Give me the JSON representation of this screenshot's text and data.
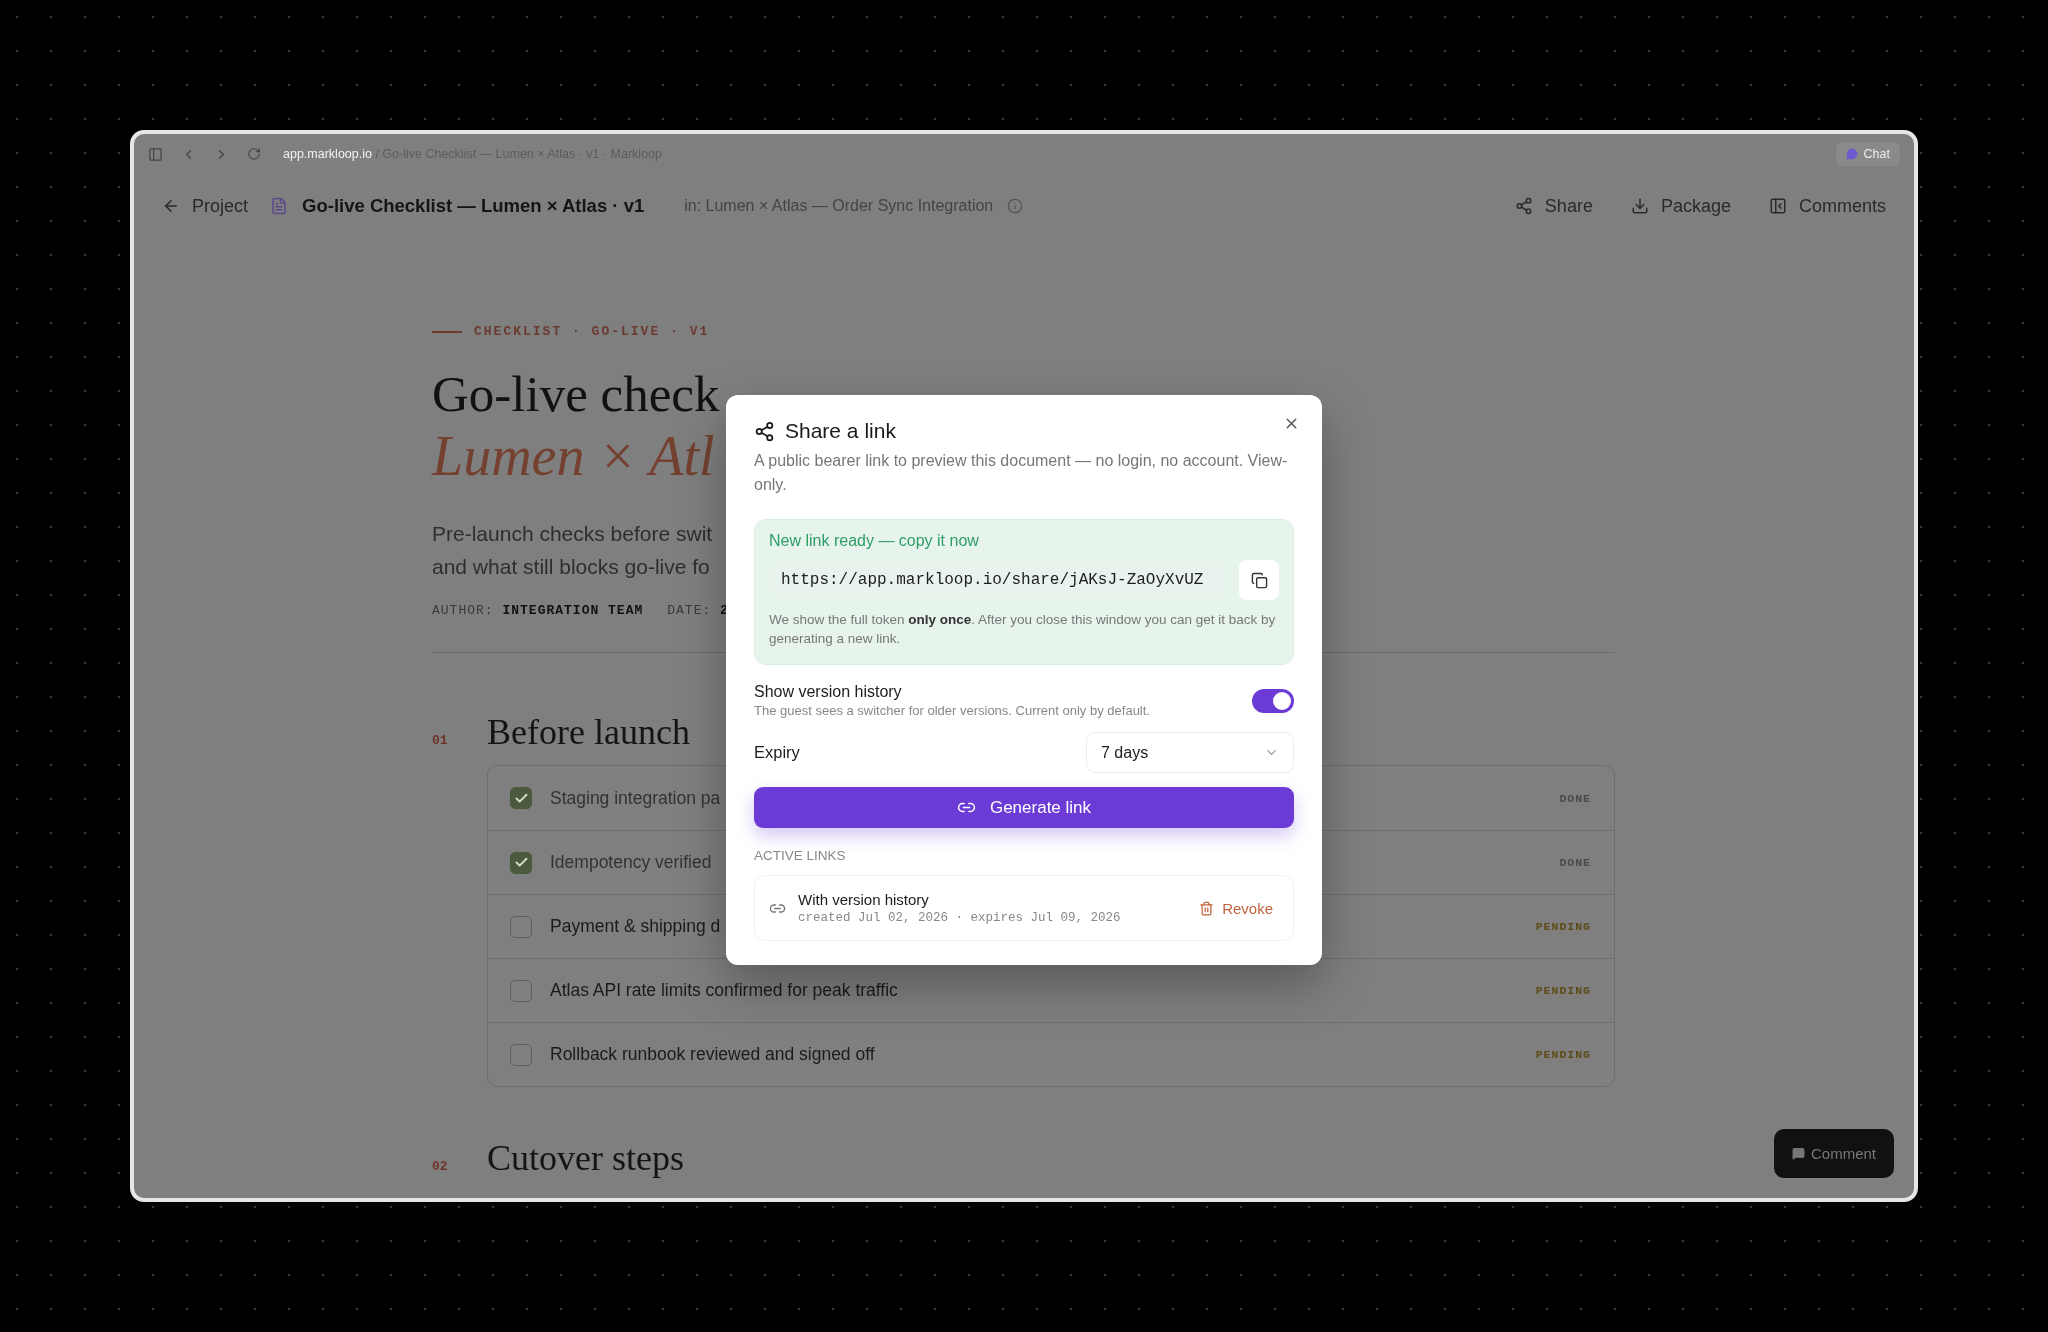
{
  "browser": {
    "url_host": "app.markloop.io",
    "url_path": " / Go-live Checklist — Lumen × Atlas · v1 · Markloop",
    "chat_button": "Chat"
  },
  "header": {
    "back_label": "Project",
    "doc_title": "Go-live Checklist — Lumen × Atlas · v1",
    "context": "in: Lumen × Atlas — Order Sync Integration",
    "actions": [
      {
        "kind": "share",
        "label": "Share"
      },
      {
        "kind": "download",
        "label": "Package"
      },
      {
        "kind": "panel",
        "label": "Comments"
      }
    ]
  },
  "document": {
    "eyebrow": "CHECKLIST · GO-LIVE · V1",
    "title_line1": "Go-live check",
    "title_line2": "Lumen × Atl",
    "description_lines": [
      "Pre-launch checks before swit",
      "and what still blocks go-live fo"
    ],
    "meta": [
      {
        "label": "AUTHOR:",
        "value": "INTEGRATION TEAM"
      },
      {
        "label": "DATE:",
        "value": "2"
      }
    ]
  },
  "sections": [
    {
      "number": "01",
      "title": "Before launch",
      "items": [
        {
          "label": "Staging integration pa",
          "status": "DONE",
          "checked": true
        },
        {
          "label": "Idempotency verified",
          "status": "DONE",
          "checked": true
        },
        {
          "label": "Payment & shipping d",
          "status": "PENDING",
          "checked": false
        },
        {
          "label": "Atlas API rate limits confirmed for peak traffic",
          "status": "PENDING",
          "checked": false
        },
        {
          "label": "Rollback runbook reviewed and signed off",
          "status": "PENDING",
          "checked": false
        }
      ]
    },
    {
      "number": "02",
      "title": "Cutover steps"
    }
  ],
  "comment_button": "Comment",
  "modal": {
    "title": "Share a link",
    "description": "A public bearer link to preview this document — no login, no account. View-only.",
    "notice": {
      "heading": "New link ready — copy it now",
      "url": "https://app.markloop.io/share/jAKsJ-ZaOyXvUZ",
      "note": "We show the full token **only once**. After you close this window you can get it back by generating a new link."
    },
    "version_history": {
      "label": "Show version history",
      "hint": "The guest sees a switcher for older versions. Current only by default.",
      "on": true
    },
    "expiry": {
      "label": "Expiry",
      "value": "7 days"
    },
    "generate_label": "Generate link",
    "active_links_label": "ACTIVE LINKS",
    "active_links": [
      {
        "title": "With version history",
        "meta": "created Jul 02, 2026 · expires Jul 09, 2026",
        "action": "Revoke"
      }
    ]
  }
}
